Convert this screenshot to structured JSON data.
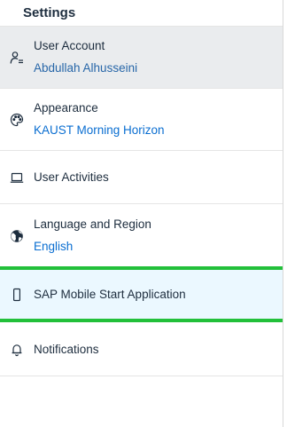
{
  "header": {
    "title": "Settings"
  },
  "items": [
    {
      "id": "user-account",
      "icon": "user-settings-icon",
      "title": "User Account",
      "subtitle": "Abdullah Alhusseini"
    },
    {
      "id": "appearance",
      "icon": "palette-icon",
      "title": "Appearance",
      "subtitle": "KAUST Morning Horizon"
    },
    {
      "id": "user-activities",
      "icon": "laptop-icon",
      "title": "User Activities"
    },
    {
      "id": "language-region",
      "icon": "globe-icon",
      "title": "Language and Region",
      "subtitle": "English"
    },
    {
      "id": "sap-mobile-start",
      "icon": "mobile-phone-icon",
      "title": "SAP Mobile Start Application"
    },
    {
      "id": "notifications",
      "icon": "bell-icon",
      "title": "Notifications"
    }
  ],
  "colors": {
    "highlight_border": "#22c03a",
    "highlight_background": "#ebf8ff",
    "selected_background": "#eaecee",
    "link_text": "#0a6ed1",
    "primary_text": "#1d2d3e"
  }
}
